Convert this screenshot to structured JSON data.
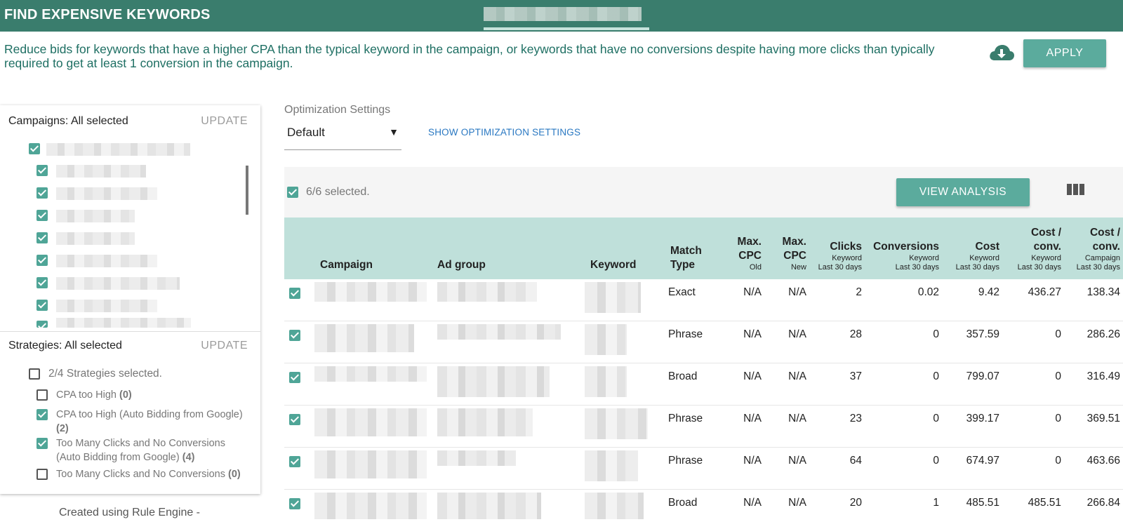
{
  "header": {
    "title": "FIND EXPENSIVE KEYWORDS"
  },
  "description": "Reduce bids for keywords that have a higher CPA than the typical keyword in the campaign, or keywords that have no conversions despite having more clicks than typically required to get at least 1 conversion in the campaign.",
  "apply_label": "APPLY",
  "left_panel": {
    "campaigns_label": "Campaigns: All selected",
    "campaigns_update": "UPDATE",
    "strategies_label": "Strategies: All selected",
    "strategies_update": "UPDATE",
    "strategies_summary": "2/4 Strategies selected.",
    "strategies": [
      {
        "label": "CPA too High",
        "count": "(0)",
        "checked": false
      },
      {
        "label": "CPA too High (Auto Bidding from Google)",
        "count": "(2)",
        "checked": true
      },
      {
        "label": "Too Many Clicks and No Conversions (Auto Bidding from Google)",
        "count": "(4)",
        "checked": true
      },
      {
        "label": "Too Many Clicks and No Conversions",
        "count": "(0)",
        "checked": false
      }
    ],
    "footer": "Created using Rule Engine -"
  },
  "optimization": {
    "label": "Optimization Settings",
    "value": "Default",
    "show_link": "SHOW OPTIMIZATION SETTINGS"
  },
  "toolbar": {
    "selected_text": "6/6 selected.",
    "view_analysis": "VIEW ANALYSIS"
  },
  "table": {
    "columns": {
      "campaign": "Campaign",
      "ad_group": "Ad group",
      "keyword": "Keyword",
      "match_type_1": "Match",
      "match_type_2": "Type",
      "maxcpc_old_1": "Max.",
      "maxcpc_old_2": "CPC",
      "maxcpc_old_sub": "Old",
      "maxcpc_new_1": "Max.",
      "maxcpc_new_2": "CPC",
      "maxcpc_new_sub": "New",
      "clicks": "Clicks",
      "clicks_sub1": "Keyword",
      "clicks_sub2": "Last 30 days",
      "conversions": "Conversions",
      "conversions_sub1": "Keyword",
      "conversions_sub2": "Last 30 days",
      "cost": "Cost",
      "cost_sub1": "Keyword",
      "cost_sub2": "Last 30 days",
      "cpc_kw_1": "Cost /",
      "cpc_kw_2": "conv.",
      "cpc_kw_sub1": "Keyword",
      "cpc_kw_sub2": "Last 30 days",
      "cpc_camp_1": "Cost /",
      "cpc_camp_2": "conv.",
      "cpc_camp_sub1": "Campaign",
      "cpc_camp_sub2": "Last 30 days"
    },
    "rows": [
      {
        "match_type": "Exact",
        "max_cpc_old": "N/A",
        "max_cpc_new": "N/A",
        "clicks": "2",
        "conversions": "0.02",
        "cost": "9.42",
        "cost_conv_kw": "436.27",
        "cost_conv_campaign": "138.34"
      },
      {
        "match_type": "Phrase",
        "max_cpc_old": "N/A",
        "max_cpc_new": "N/A",
        "clicks": "28",
        "conversions": "0",
        "cost": "357.59",
        "cost_conv_kw": "0",
        "cost_conv_campaign": "286.26"
      },
      {
        "match_type": "Broad",
        "max_cpc_old": "N/A",
        "max_cpc_new": "N/A",
        "clicks": "37",
        "conversions": "0",
        "cost": "799.07",
        "cost_conv_kw": "0",
        "cost_conv_campaign": "316.49"
      },
      {
        "match_type": "Phrase",
        "max_cpc_old": "N/A",
        "max_cpc_new": "N/A",
        "clicks": "23",
        "conversions": "0",
        "cost": "399.17",
        "cost_conv_kw": "0",
        "cost_conv_campaign": "369.51"
      },
      {
        "match_type": "Phrase",
        "max_cpc_old": "N/A",
        "max_cpc_new": "N/A",
        "clicks": "64",
        "conversions": "0",
        "cost": "674.97",
        "cost_conv_kw": "0",
        "cost_conv_campaign": "463.66"
      },
      {
        "match_type": "Broad",
        "max_cpc_old": "N/A",
        "max_cpc_new": "N/A",
        "clicks": "20",
        "conversions": "1",
        "cost": "485.51",
        "cost_conv_kw": "485.51",
        "cost_conv_campaign": "266.84"
      }
    ]
  },
  "colors": {
    "header": "#3a7d6d",
    "accent": "#5bab9d",
    "table_header": "#bfe0da",
    "link": "#2a78c2"
  }
}
